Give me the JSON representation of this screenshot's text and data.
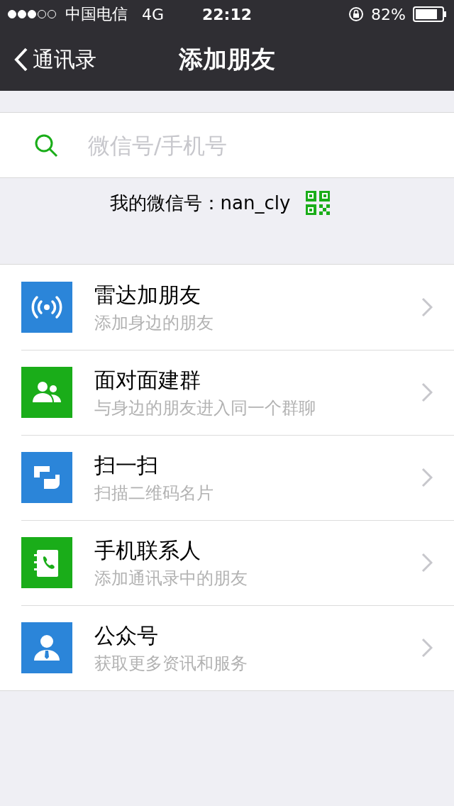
{
  "status_bar": {
    "carrier": "中国电信",
    "network": "4G",
    "time": "22:12",
    "battery": "82%"
  },
  "nav": {
    "back": "通讯录",
    "title": "添加朋友"
  },
  "search": {
    "placeholder": "微信号/手机号"
  },
  "my_id": {
    "label": "我的微信号：nan_cly"
  },
  "items": [
    {
      "kind": "radar",
      "color": "#2b85d9",
      "title": "雷达加朋友",
      "subtitle": "添加身边的朋友"
    },
    {
      "kind": "group",
      "color": "#1aad19",
      "title": "面对面建群",
      "subtitle": "与身边的朋友进入同一个群聊"
    },
    {
      "kind": "scan",
      "color": "#2b85d9",
      "title": "扫一扫",
      "subtitle": "扫描二维码名片"
    },
    {
      "kind": "contacts",
      "color": "#1aad19",
      "title": "手机联系人",
      "subtitle": "添加通讯录中的朋友"
    },
    {
      "kind": "official",
      "color": "#2b85d9",
      "title": "公众号",
      "subtitle": "获取更多资讯和服务"
    }
  ]
}
